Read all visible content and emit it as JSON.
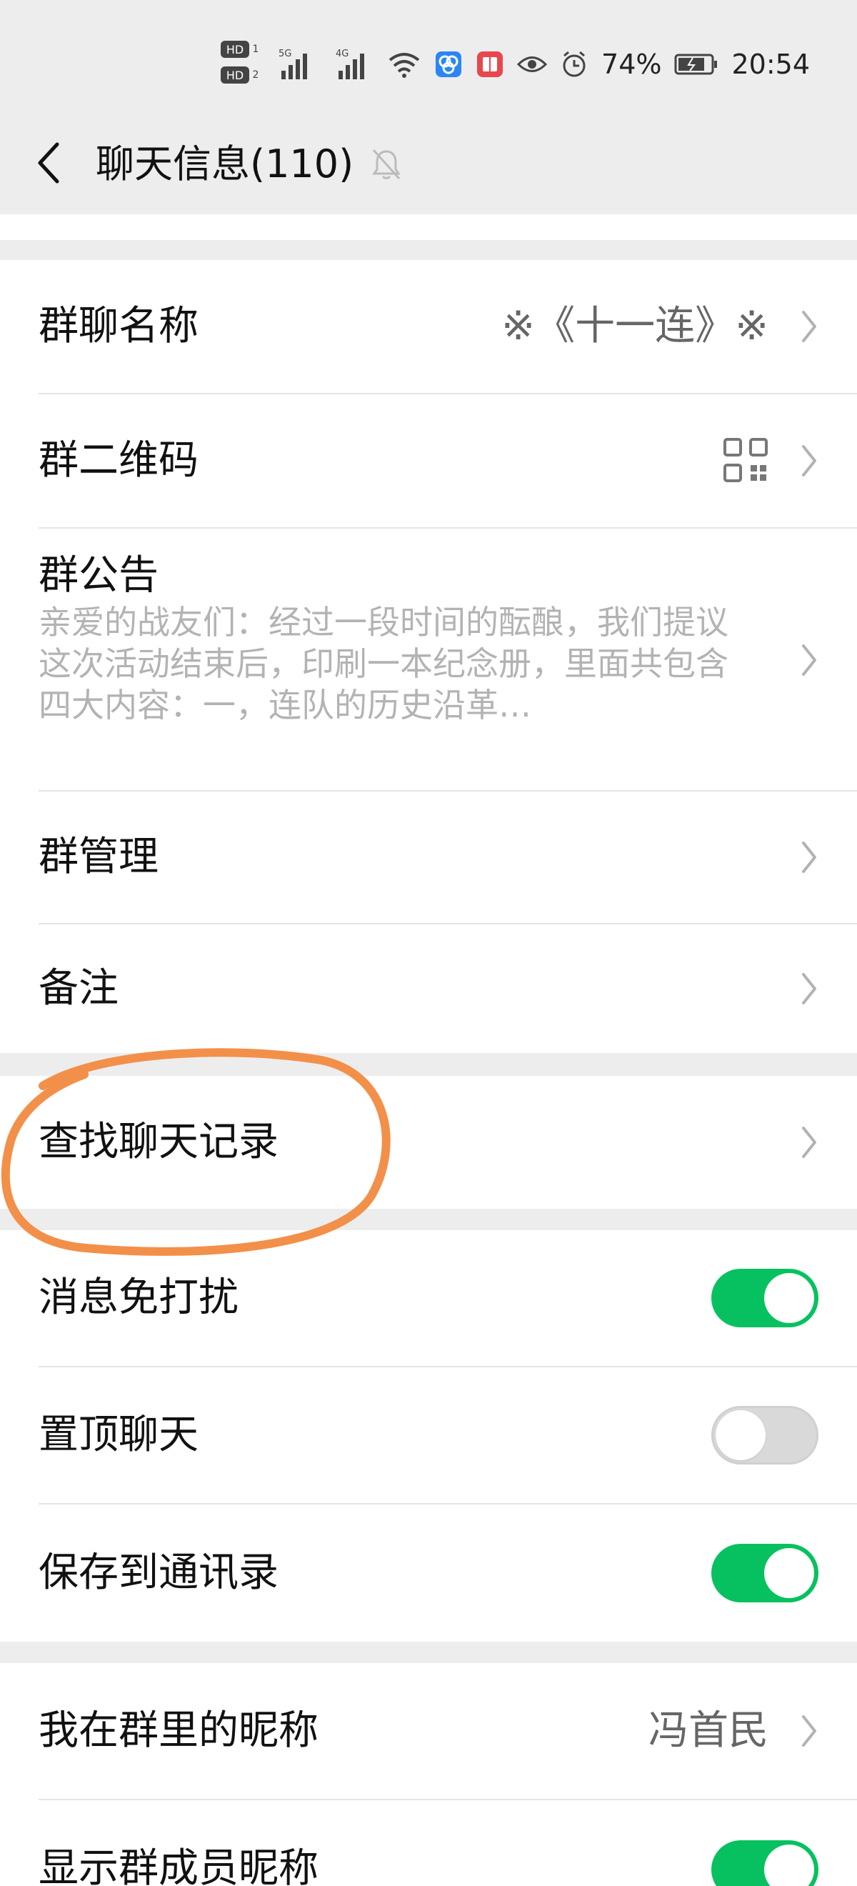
{
  "status_bar": {
    "battery": "74%",
    "time": "20:54",
    "icons": [
      "hd-icon",
      "signal-5g-icon",
      "signal-4g-icon",
      "wifi-icon",
      "app-icon",
      "eye-icon",
      "alarm-icon",
      "battery-icon"
    ],
    "hd_top": "HD",
    "hd_bottom": "HD",
    "sig_5g": "5G",
    "sig_4g": "4G"
  },
  "header": {
    "title": "聊天信息(110)",
    "back_icon": "back-arrow-icon",
    "mute_icon": "bell-off-icon"
  },
  "group": {
    "name_label": "群聊名称",
    "name_value": "※《十一连》※",
    "qr_label": "群二维码",
    "announcement_label": "群公告",
    "announcement_text": "亲爱的战友们：经过一段时间的酝酿，我们提议这次活动结束后，印刷一本纪念册，里面共包含四大内容：一，连队的历史沿革…",
    "manage_label": "群管理",
    "remark_label": "备注"
  },
  "search": {
    "label": "查找聊天记录"
  },
  "settings": {
    "mute_label": "消息免打扰",
    "mute_on": true,
    "pin_label": "置顶聊天",
    "pin_on": false,
    "save_label": "保存到通讯录",
    "save_on": true
  },
  "profile": {
    "nickname_label": "我在群里的昵称",
    "nickname_value": "冯首民",
    "show_names_label": "显示群成员昵称",
    "show_names_on": true
  },
  "colors": {
    "accent": "#07c160",
    "highlight": "#f2904a",
    "background": "#ededed"
  }
}
